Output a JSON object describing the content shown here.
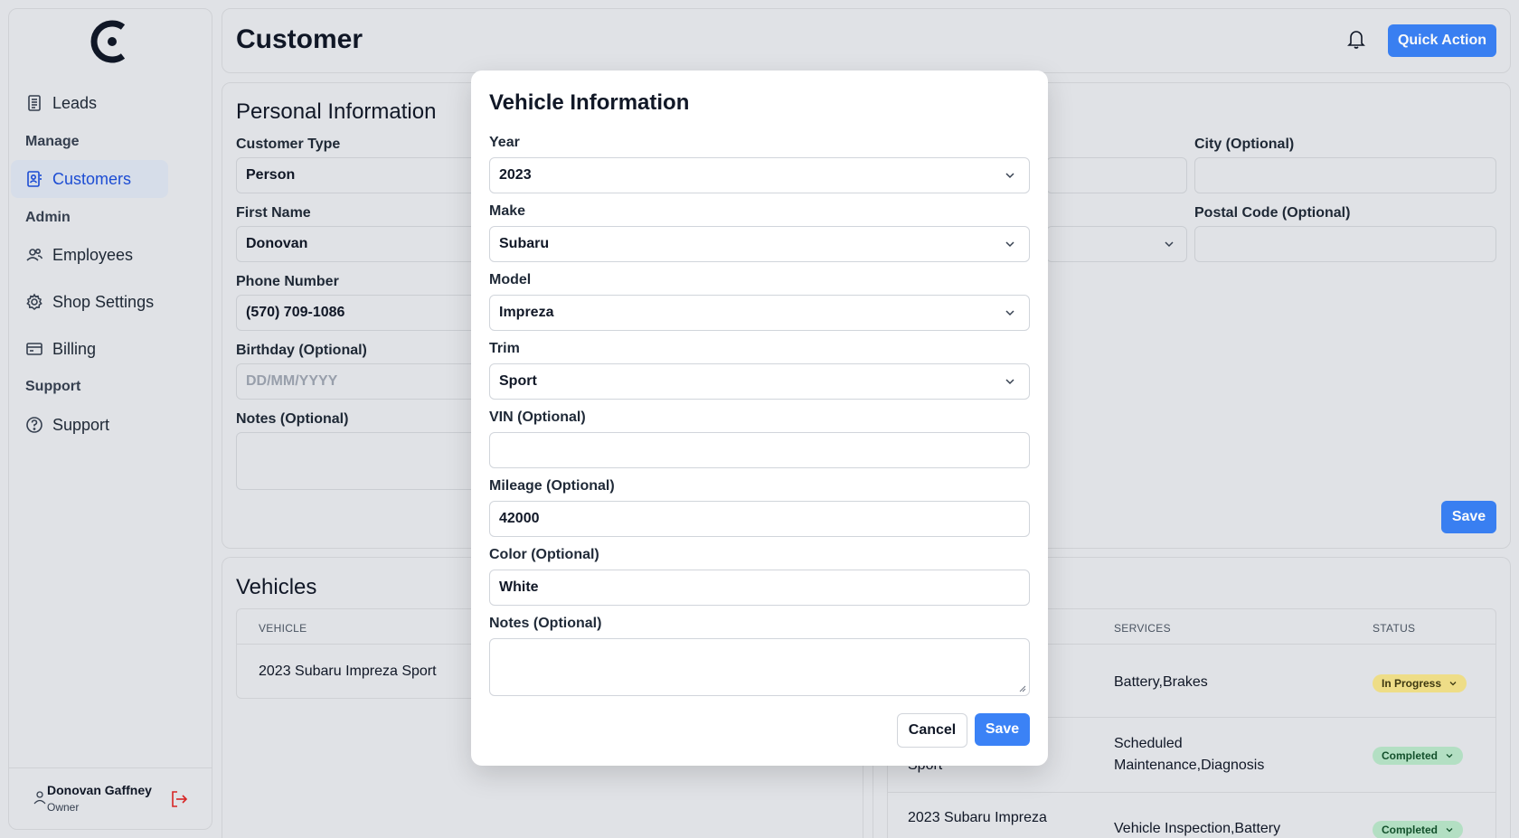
{
  "app": {
    "page_title": "Customer",
    "quick_action_label": "Quick Action"
  },
  "sidebar": {
    "items": [
      {
        "label": "Leads",
        "icon": "document-icon"
      },
      {
        "section": "Manage"
      },
      {
        "label": "Customers",
        "icon": "contact-card-icon",
        "active": true
      },
      {
        "section": "Admin"
      },
      {
        "label": "Employees",
        "icon": "users-icon"
      },
      {
        "label": "Shop Settings",
        "icon": "gear-icon"
      },
      {
        "label": "Billing",
        "icon": "credit-card-icon"
      },
      {
        "section": "Support"
      },
      {
        "label": "Support",
        "icon": "help-circle-icon"
      }
    ],
    "user": {
      "name": "Donovan Gaffney",
      "role": "Owner"
    }
  },
  "personal": {
    "title": "Personal Information",
    "customer_type_label": "Customer Type",
    "customer_type_value": "Person",
    "first_name_label": "First Name",
    "first_name_value": "Donovan",
    "phone_label": "Phone Number",
    "phone_value": "(570) 709-1086",
    "birthday_label": "Birthday (Optional)",
    "birthday_placeholder": "DD/MM/YYYY",
    "notes_label": "Notes (Optional)",
    "city_label": "City (Optional)",
    "postal_label": "Postal Code (Optional)",
    "save_label": "Save"
  },
  "vehicles": {
    "title": "Vehicles",
    "header_vehicle": "VEHICLE",
    "rows": [
      "2023 Subaru Impreza Sport"
    ]
  },
  "services": {
    "header_services": "SERVICES",
    "header_status": "STATUS",
    "rows": [
      {
        "vehicle": "",
        "services": "Battery,Brakes",
        "status": "In Progress",
        "status_color": "#f3e28a"
      },
      {
        "vehicle": "Sport",
        "services_line1": "Scheduled",
        "services_line2": "Maintenance,Diagnosis",
        "status": "Completed",
        "status_color": "#b7e4c7"
      },
      {
        "vehicle": "2023 Subaru Impreza",
        "services": "Vehicle Inspection,Battery",
        "status": "Completed",
        "status_color": "#b7e4c7"
      }
    ]
  },
  "modal": {
    "title": "Vehicle Information",
    "year_label": "Year",
    "year_value": "2023",
    "make_label": "Make",
    "make_value": "Subaru",
    "model_label": "Model",
    "model_value": "Impreza",
    "trim_label": "Trim",
    "trim_value": "Sport",
    "vin_label": "VIN (Optional)",
    "vin_value": "",
    "mileage_label": "Mileage (Optional)",
    "mileage_value": "42000",
    "color_label": "Color (Optional)",
    "color_value": "White",
    "notes_label": "Notes (Optional)",
    "cancel_label": "Cancel",
    "save_label": "Save"
  }
}
